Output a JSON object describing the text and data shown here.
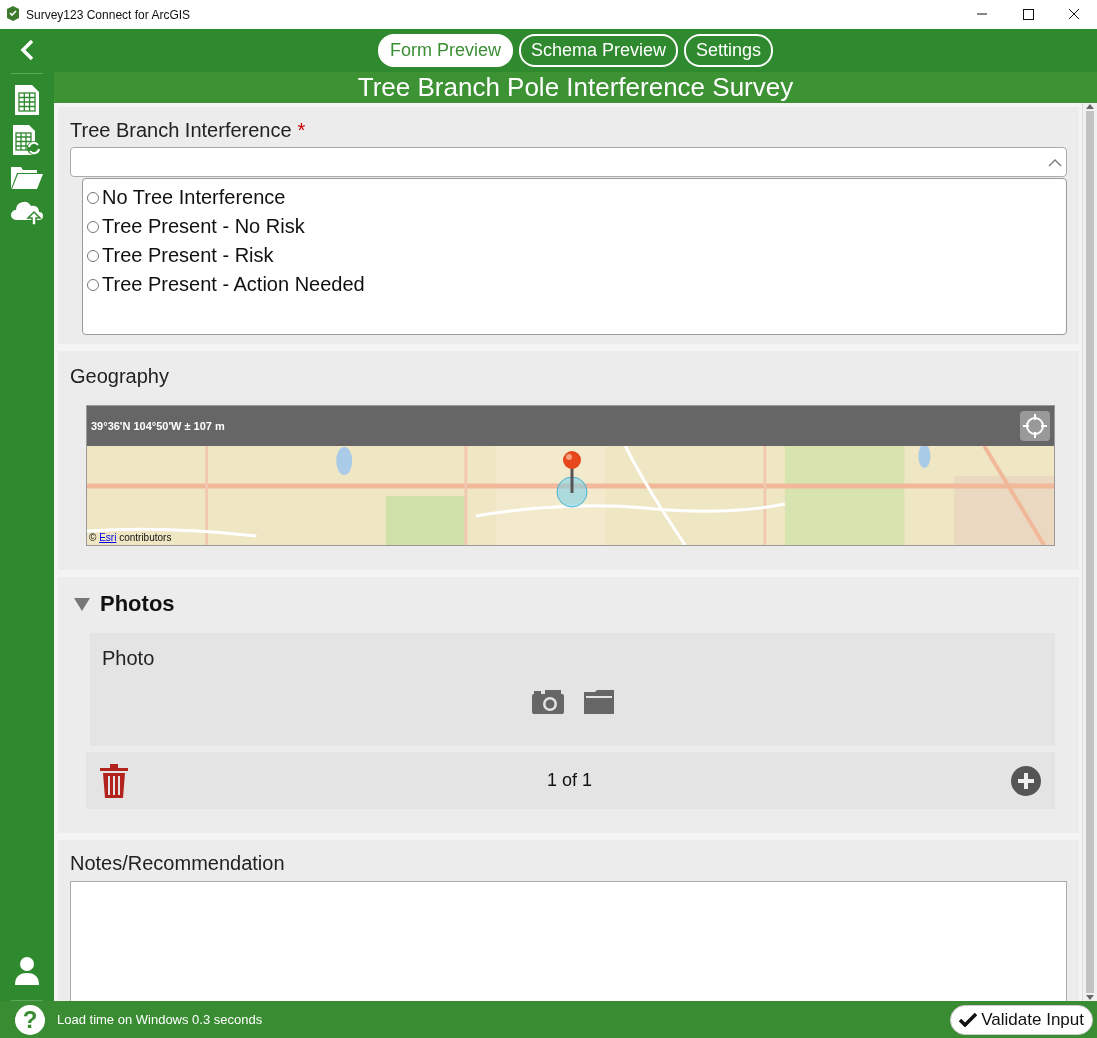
{
  "window": {
    "title": "Survey123 Connect for ArcGIS"
  },
  "tabs": [
    {
      "label": "Form Preview",
      "selected": true
    },
    {
      "label": "Schema Preview",
      "selected": false
    },
    {
      "label": "Settings",
      "selected": false
    }
  ],
  "survey_title": "Tree Branch Pole Interference Survey",
  "questions": [
    {
      "kind": "select_one",
      "label": "Tree Branch Interference",
      "required_mark": "*",
      "options": [
        {
          "label": "No Tree Interference",
          "selected": false
        },
        {
          "label": "Tree Present - No Risk",
          "selected": false
        },
        {
          "label": "Tree Present - Risk",
          "selected": false
        },
        {
          "label": "Tree Present - Action Needed",
          "selected": false
        }
      ]
    },
    {
      "kind": "geopoint",
      "label": "Geography",
      "location": "39°36'N 104°50'W  ± 107 m",
      "attribution": {
        "prefix": "©",
        "link": "Esri",
        "suffix": "contributors"
      }
    },
    {
      "kind": "group",
      "label": "Photos",
      "expanded": true,
      "photo_label": "Photo",
      "counter": "1 of 1"
    },
    {
      "kind": "text",
      "label": "Notes/Recommendation"
    }
  ],
  "status_bar": {
    "help": "?",
    "message": "Load time on Windows 0.3 seconds",
    "validate_button": "Validate Input"
  }
}
